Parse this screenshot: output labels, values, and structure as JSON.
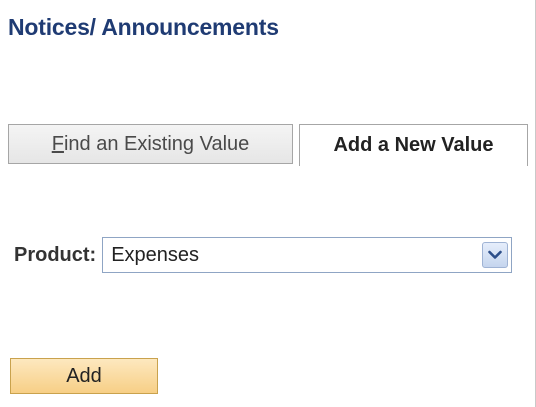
{
  "page": {
    "title": "Notices/ Announcements"
  },
  "tabs": {
    "find_existing": {
      "first_char": "F",
      "rest": "ind an Existing Value"
    },
    "add_new": {
      "label": "Add a New Value"
    }
  },
  "form": {
    "product_label": "Product:",
    "product_value": "Expenses",
    "dropdown_icon": "chevron-down-icon"
  },
  "actions": {
    "add_label": "Add"
  },
  "colors": {
    "title": "#1f3b73",
    "add_button_bg": "#f7cf86"
  }
}
